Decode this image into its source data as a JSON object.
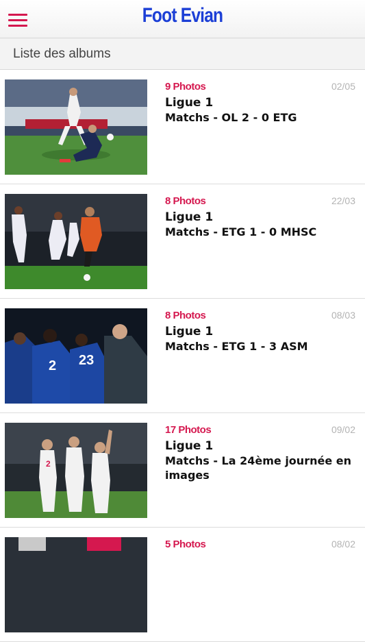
{
  "header": {
    "title": "Foot Evian",
    "menu_icon": "hamburger-menu-icon",
    "accent": "#d5184f",
    "title_color": "#1c3fd6"
  },
  "subheader": {
    "title": "Liste des albums"
  },
  "albums": [
    {
      "count": "9 Photos",
      "date": "02/05",
      "category": "Ligue 1",
      "title": "Matchs - OL 2 - 0 ETG"
    },
    {
      "count": "8 Photos",
      "date": "22/03",
      "category": "Ligue 1",
      "title": "Matchs - ETG 1 - 0 MHSC"
    },
    {
      "count": "8 Photos",
      "date": "08/03",
      "category": "Ligue 1",
      "title": "Matchs - ETG 1 - 3 ASM"
    },
    {
      "count": "17 Photos",
      "date": "09/02",
      "category": "Ligue 1",
      "title": "Matchs - La 24ème journée en images"
    },
    {
      "count": "5 Photos",
      "date": "08/02",
      "category": "",
      "title": ""
    }
  ]
}
